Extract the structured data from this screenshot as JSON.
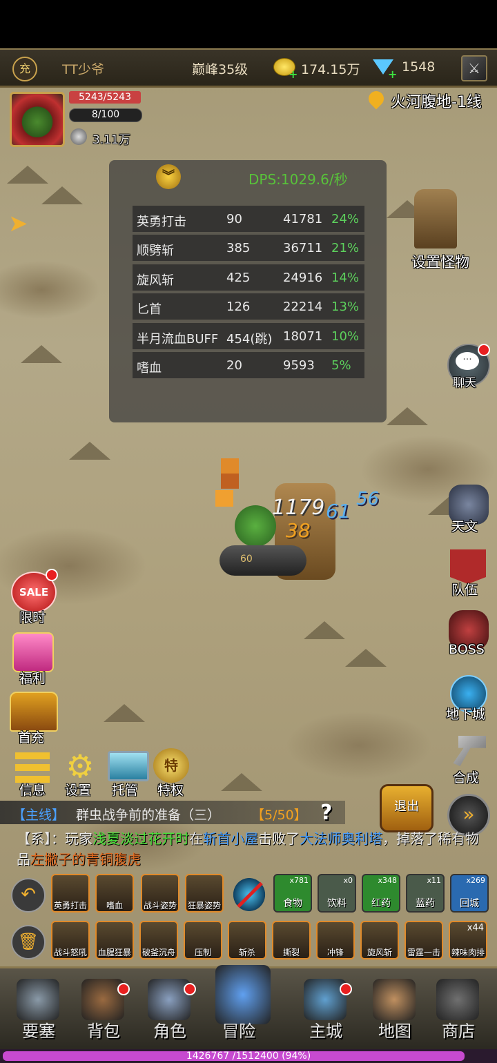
{
  "topbar": {
    "recharge_icon_text": "充",
    "player_name": "TT少爷",
    "level": "巅峰35级",
    "gold": "174.15万",
    "diamonds": "1548"
  },
  "player": {
    "hp": "5243/5243",
    "energy": "8/100",
    "power": "3.11万",
    "location": "火河腹地-1线"
  },
  "dps": {
    "title": "DPS:1029.6/秒",
    "rows": [
      {
        "name": "英勇打击",
        "hits": "90",
        "damage": "41781",
        "pct": "24%"
      },
      {
        "name": "顺劈斩",
        "hits": "385",
        "damage": "36711",
        "pct": "21%"
      },
      {
        "name": "旋风斩",
        "hits": "425",
        "damage": "24916",
        "pct": "14%"
      },
      {
        "name": "匕首",
        "hits": "126",
        "damage": "22214",
        "pct": "13%"
      },
      {
        "name": "半月流血BUFF",
        "hits": "454(跳)",
        "damage": "18071",
        "pct": "10%"
      },
      {
        "name": "嗜血",
        "hits": "20",
        "damage": "9593",
        "pct": "5%"
      }
    ]
  },
  "right_menu": {
    "set_monster": "设置怪物",
    "chat": "聊天",
    "tianwen": "天文",
    "team": "队伍",
    "boss": "BOSS",
    "dungeon": "地下城",
    "compose": "合成"
  },
  "left_menu": {
    "sale_text": "SALE",
    "limited": "限时",
    "welfare": "福利",
    "first_charge": "首充",
    "info": "信息",
    "settings": "设置",
    "auto": "托管",
    "privilege_badge": "特",
    "privilege": "特权"
  },
  "battle": {
    "dmg1": "1179",
    "dmg2": "56",
    "dmg3": "61",
    "dmg4": "38",
    "wheel_level": "60"
  },
  "quest": {
    "tag": "【主线】",
    "text": "群虫战争前的准备（三）",
    "progress": "【5/50】",
    "hint": "?"
  },
  "exit_label": "退出",
  "system_msg": {
    "prefix": "【系】：玩家",
    "player": "浅夏淡过花开时",
    "mid1": "在",
    "place": "斩首小屋",
    "mid2": "击败了",
    "boss": "大法师奥利塔",
    "mid3": "，掉落了稀有物品",
    "item": "左撇子的青铜腹虎"
  },
  "skills_row1": [
    {
      "label": "英勇打击"
    },
    {
      "label": "嗜血"
    },
    {
      "label": "战斗姿势"
    },
    {
      "label": "狂暴姿势"
    }
  ],
  "items_row1": [
    {
      "label": "食物",
      "count": "x781",
      "color": "#2e8a2e"
    },
    {
      "label": "饮料",
      "count": "x0",
      "color": "#4a5a4a"
    },
    {
      "label": "红药",
      "count": "x348",
      "color": "#2e8a2e"
    },
    {
      "label": "蓝药",
      "count": "x11",
      "color": "#4a5a4a"
    },
    {
      "label": "回城",
      "count": "x269",
      "color": "#2a6ab0"
    }
  ],
  "skills_row2": [
    {
      "label": "战斗怒吼"
    },
    {
      "label": "血腥狂暴"
    },
    {
      "label": "破釜沉舟"
    },
    {
      "label": "压制"
    },
    {
      "label": "斩杀"
    },
    {
      "label": "撕裂"
    },
    {
      "label": "冲锋"
    },
    {
      "label": "旋风斩"
    },
    {
      "label": "雷霆一击"
    },
    {
      "label": "辣味肉排",
      "count": "x44"
    }
  ],
  "nav": [
    {
      "label": "要塞"
    },
    {
      "label": "背包"
    },
    {
      "label": "角色"
    },
    {
      "label": "冒险"
    },
    {
      "label": "主城"
    },
    {
      "label": "地图"
    },
    {
      "label": "商店"
    }
  ],
  "exp": {
    "text": "1426767 /1512400 (94%)",
    "fraction": 0.94
  },
  "colors": {
    "dps_title": "#58c23a",
    "pct": "#5cd05c",
    "quest_tag": "#4aa0ff",
    "player_name": "#4ae03a",
    "place": "#4aa0ff",
    "boss": "#4aa0ff",
    "item": "#e06a20"
  }
}
